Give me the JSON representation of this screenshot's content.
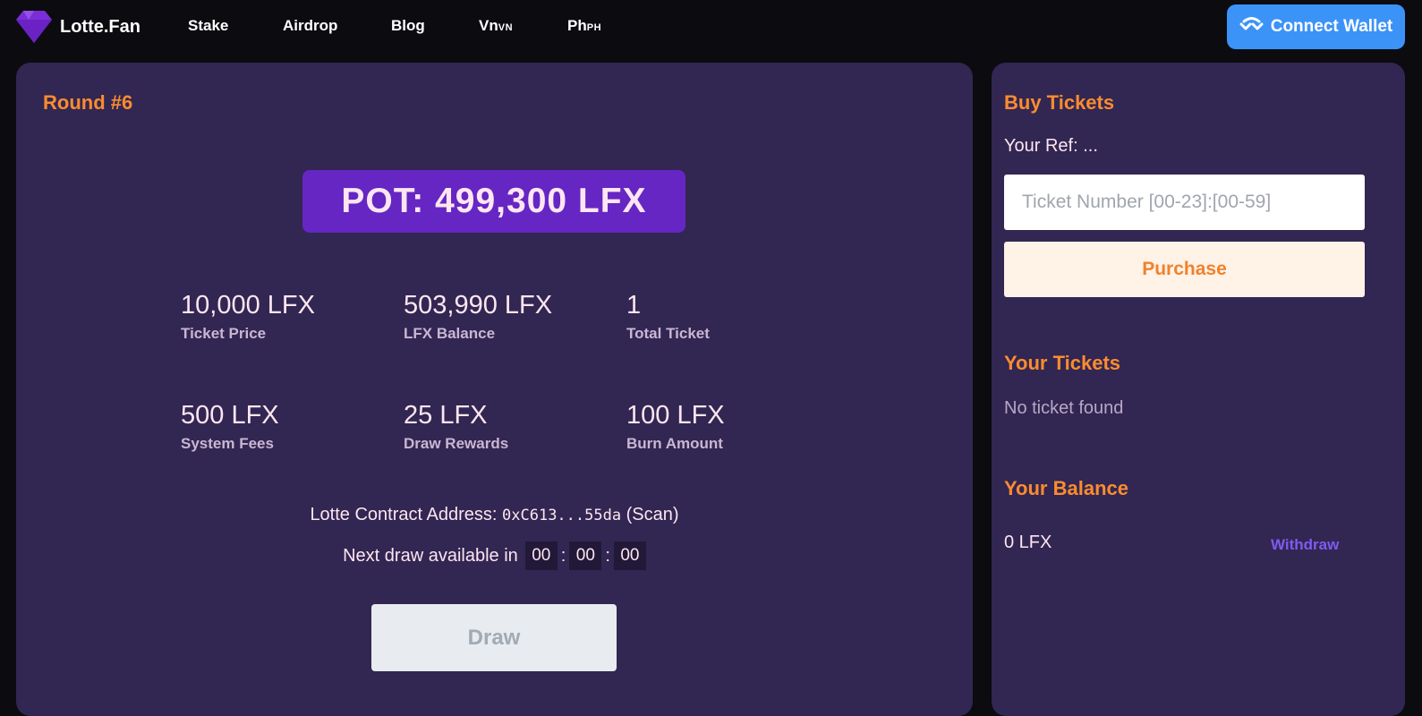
{
  "header": {
    "brand": "Lotte.Fan",
    "nav": [
      {
        "label": "Stake",
        "flag": ""
      },
      {
        "label": "Airdrop",
        "flag": ""
      },
      {
        "label": "Blog",
        "flag": ""
      },
      {
        "label": "Vn",
        "flag": "VN"
      },
      {
        "label": "Ph",
        "flag": "PH"
      }
    ],
    "connect_label": "Connect Wallet"
  },
  "round": {
    "title": "Round #6",
    "pot": "POT: 499,300 LFX",
    "stats": [
      {
        "value": "10,000 LFX",
        "label": "Ticket Price"
      },
      {
        "value": "503,990 LFX",
        "label": "LFX Balance"
      },
      {
        "value": "1",
        "label": "Total Ticket"
      },
      {
        "value": "500 LFX",
        "label": "System Fees"
      },
      {
        "value": "25 LFX",
        "label": "Draw Rewards"
      },
      {
        "value": "100 LFX",
        "label": "Burn Amount"
      }
    ],
    "contract_label": "Lotte Contract Address:",
    "contract_address": "0xC613...55da",
    "scan_label": "(Scan)",
    "next_draw_label": "Next draw available in",
    "countdown": {
      "h": "00",
      "m": "00",
      "s": "00"
    },
    "draw_label": "Draw"
  },
  "sidebar": {
    "buy_title": "Buy Tickets",
    "ref_text": "Your Ref: ...",
    "ticket_placeholder": "Ticket Number [00-23]:[00-59]",
    "purchase_label": "Purchase",
    "tickets_title": "Your Tickets",
    "no_ticket_text": "No ticket found",
    "balance_title": "Your Balance",
    "balance_value": "0 LFX",
    "withdraw_label": "Withdraw"
  },
  "colors": {
    "accent_orange": "#fb8c2f",
    "panel": "#322652",
    "pot_bg": "#6526c4",
    "connect_blue": "#3b93f7",
    "withdraw_purple": "#7f5af0"
  },
  "icons": [
    "gem-logo-icon",
    "walletconnect-icon"
  ]
}
